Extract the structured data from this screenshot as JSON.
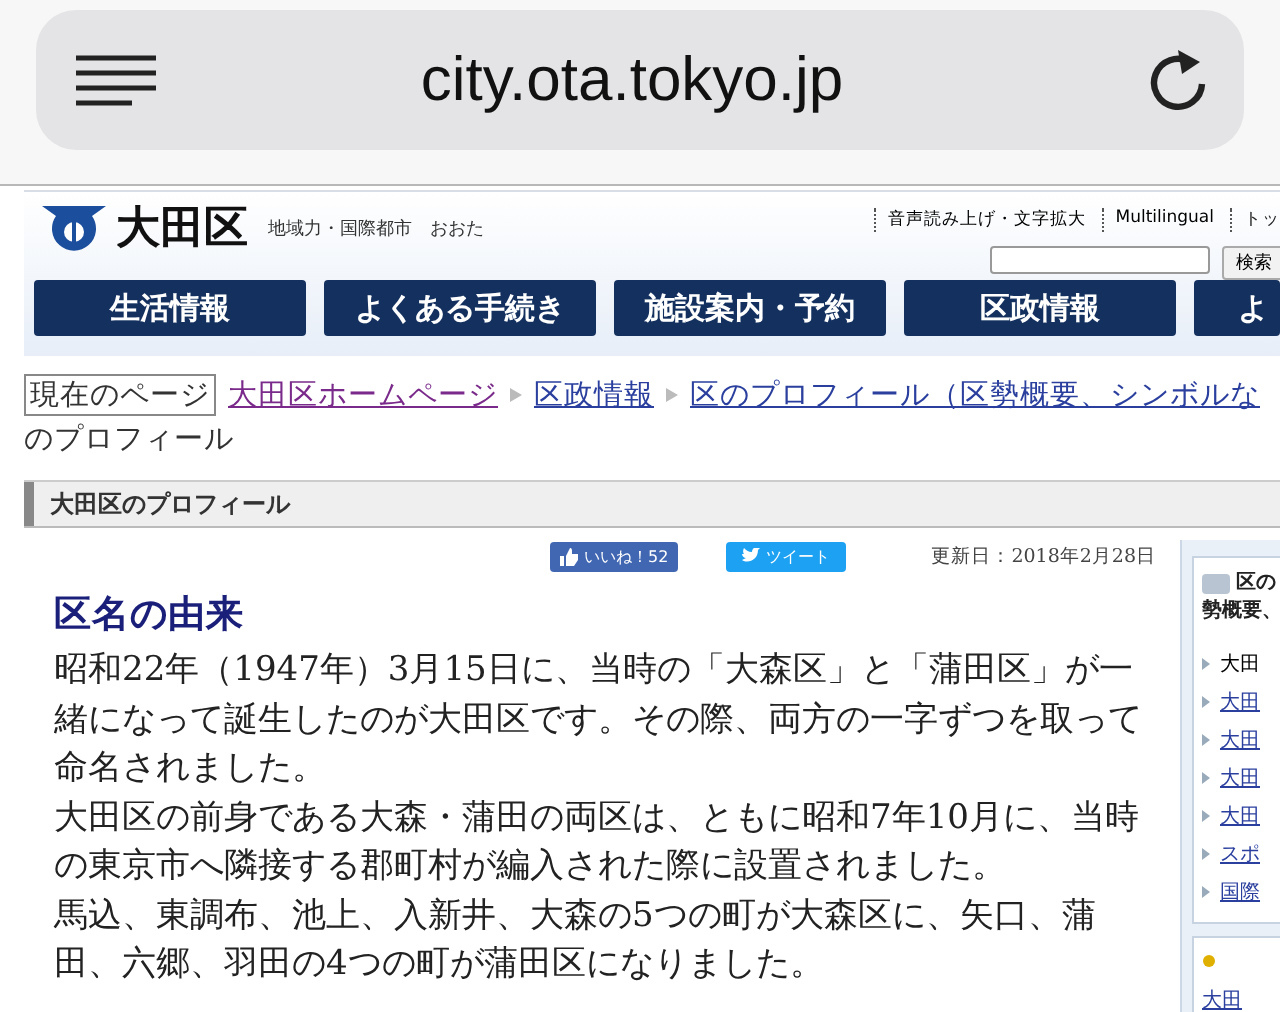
{
  "browser": {
    "address": "city.ota.tokyo.jp"
  },
  "header": {
    "logo_text": "大田区",
    "tagline": "地域力・国際都市　おおた",
    "utility_links": [
      "音声読み上げ・文字拡大",
      "Multilingual",
      "トッ"
    ],
    "search_button": "検索",
    "nav": [
      "生活情報",
      "よくある手続き",
      "施設案内・予約",
      "区政情報",
      "よ"
    ]
  },
  "breadcrumb": {
    "label": "現在のページ",
    "links": [
      {
        "text": "大田区ホームページ",
        "visited": true
      },
      {
        "text": "区政情報",
        "visited": false
      },
      {
        "text": "区のプロフィール（区勢概要、シンボルな",
        "visited": false
      }
    ],
    "current": "のプロフィール"
  },
  "page_title": "大田区のプロフィール",
  "social": {
    "like": "いいね！52",
    "tweet": "ツイート"
  },
  "updated": "更新日：2018年2月28日",
  "article": {
    "heading": "区名の由来",
    "paragraphs": [
      "昭和22年（1947年）3月15日に、当時の「大森区」と「蒲田区」が一緒になって誕生したのが大田区です。その際、両方の一字ずつを取って命名されました。",
      "大田区の前身である大森・蒲田の両区は、ともに昭和7年10月に、当時の東京市へ隣接する郡町村が編入された際に設置されました。",
      "馬込、東調布、池上、入新井、大森の5つの町が大森区に、矢口、蒲田、六郷、羽田の4つの町が蒲田区になりました。"
    ]
  },
  "sidebar": {
    "title_lines": [
      "区の",
      "勢概要、"
    ],
    "items": [
      {
        "text": "大田",
        "link": false
      },
      {
        "text": "大田",
        "link": true
      },
      {
        "text": "大田",
        "link": true
      },
      {
        "text": "大田",
        "link": true
      },
      {
        "text": "大田",
        "link": true
      },
      {
        "text": "スポ",
        "link": true
      },
      {
        "text": "国際",
        "link": true
      }
    ],
    "next_item": "大田"
  }
}
